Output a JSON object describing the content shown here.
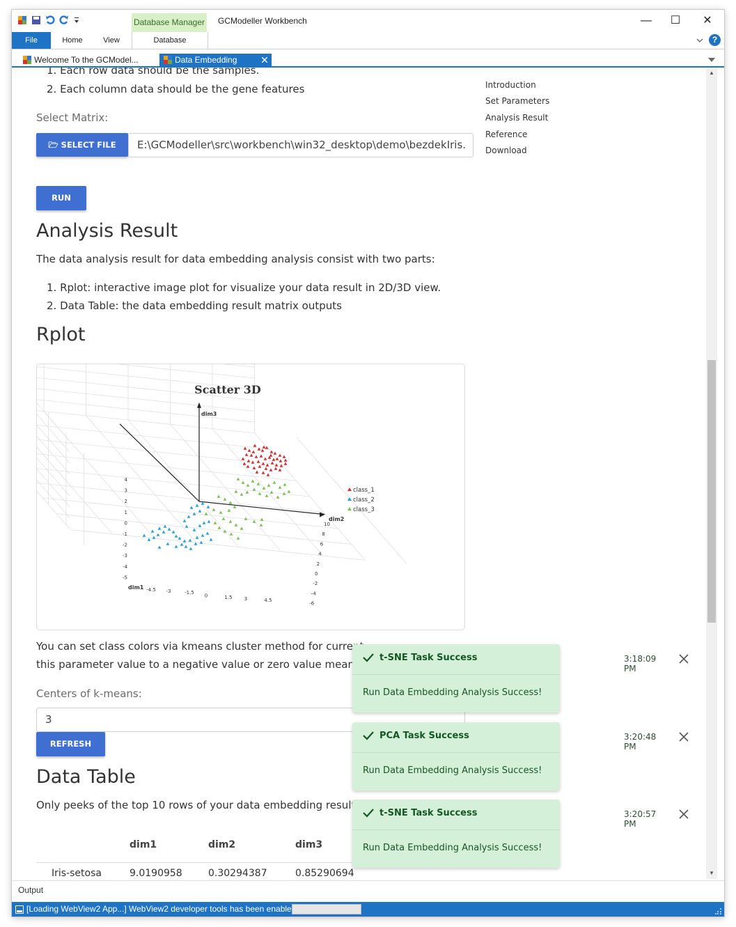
{
  "window": {
    "title": "GCModeller Workbench",
    "context_tab": "Database Manager",
    "minimize": "—",
    "maximize": "☐",
    "close": "✕"
  },
  "ribbon": {
    "tabs": [
      "File",
      "Home",
      "View",
      "Database"
    ],
    "help": "?"
  },
  "doc_tabs": [
    {
      "label": "Welcome To the GCModel...",
      "active": false
    },
    {
      "label": "Data Embedding",
      "active": true
    }
  ],
  "page": {
    "list_top": [
      "1. Each row data should be the samples.",
      "2. Each column data should be the gene features"
    ],
    "select_matrix_label": "Select Matrix:",
    "select_file_button": "SELECT FILE",
    "file_path": "E:\\GCModeller\\src\\workbench\\win32_desktop\\demo\\bezdekIris.",
    "run_button": "RUN",
    "analysis_heading": "Analysis Result",
    "analysis_text": "The data analysis result for data embedding analysis consist with two parts:",
    "analysis_items": [
      "1. Rplot: interactive image plot for visualize your data result in 2D/3D view.",
      "2. Data Table: the data embedding result matrix outputs"
    ],
    "rplot_heading": "Rplot",
    "kmeans_text_1": "You can set class colors via kmeans cluster method for current",
    "kmeans_text_2": "this parameter value to a negative value or zero value means no",
    "centers_label": "Centers of k-means:",
    "centers_value": "3",
    "refresh_button": "REFRESH",
    "table_heading": "Data Table",
    "table_text": "Only peeks of the top 10 rows of your data embedding result at",
    "table": {
      "headers": [
        "",
        "dim1",
        "dim2",
        "dim3"
      ],
      "rows": [
        [
          "Iris-setosa",
          "9.0190958",
          "0.30294387",
          "0.85290694"
        ]
      ]
    }
  },
  "toc": [
    "Introduction",
    "Set Parameters",
    "Analysis Result",
    "Reference",
    "Download"
  ],
  "chart_data": {
    "type": "scatter",
    "title": "Scatter 3D",
    "axes": {
      "x": "dim1",
      "y": "dim2",
      "z": "dim3"
    },
    "x_ticks": [
      "-4.5",
      "-3",
      "-1.5",
      "0",
      "1.5",
      "3",
      "4.5"
    ],
    "y_ticks": [
      "10",
      "8",
      "6",
      "4",
      "2",
      "0",
      "-2",
      "-4",
      "-6"
    ],
    "z_ticks": [
      "4",
      "3",
      "2",
      "1",
      "0",
      "-1",
      "-2",
      "-3",
      "-4",
      "-5"
    ],
    "legend_position": "right",
    "series": [
      {
        "name": "class_1",
        "color": "#cc3333"
      },
      {
        "name": "class_2",
        "color": "#2d9fd8"
      },
      {
        "name": "class_3",
        "color": "#7cc05a"
      }
    ]
  },
  "toasts": [
    {
      "title": "t-SNE Task Success",
      "time": "3:18:09 PM",
      "message": "Run Data Embedding Analysis Success!"
    },
    {
      "title": "PCA Task Success",
      "time": "3:20:48 PM",
      "message": "Run Data Embedding Analysis Success!"
    },
    {
      "title": "t-SNE Task Success",
      "time": "3:20:57 PM",
      "message": "Run Data Embedding Analysis Success!"
    }
  ],
  "output_label": "Output",
  "status_text": "[Loading WebView2 App...] WebView2 developer tools has been enable!",
  "colors": {
    "accent": "#1e73c4",
    "button": "#3f6fd1",
    "toast_bg": "#d5f0d9",
    "toast_text": "#155724"
  }
}
